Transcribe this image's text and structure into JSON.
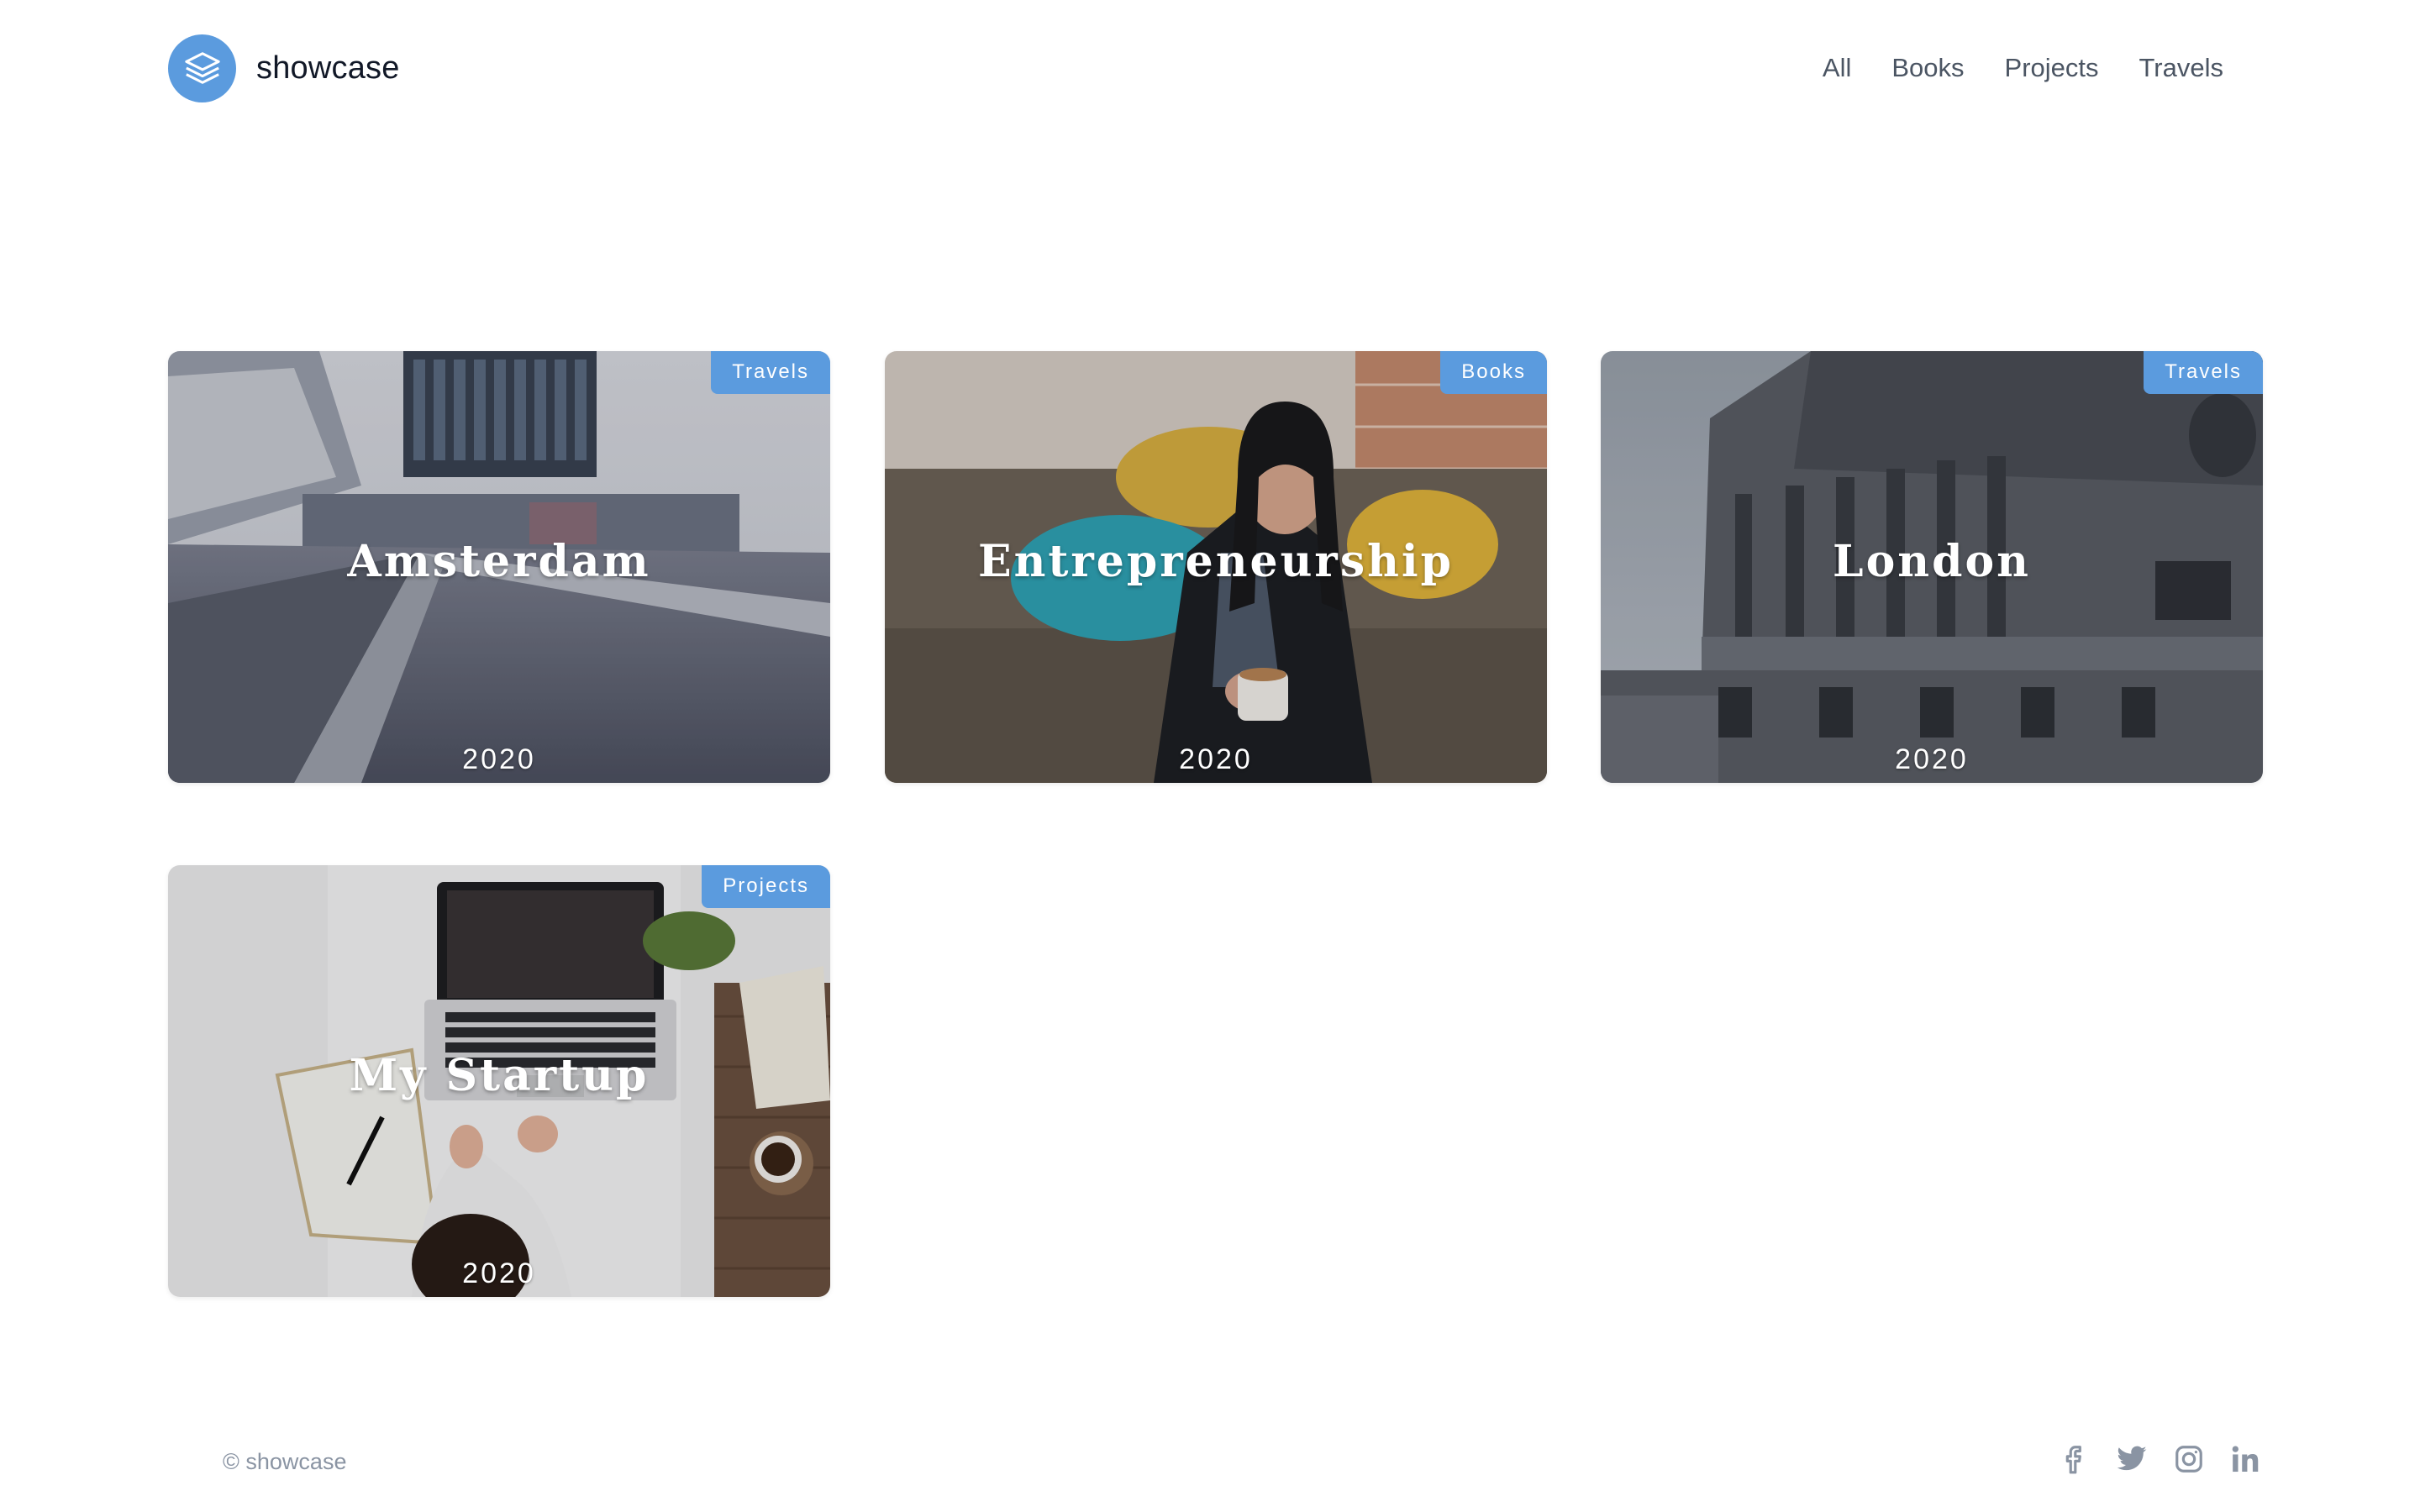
{
  "brand": {
    "name": "showcase",
    "logo_icon": "stacked-layers-icon",
    "accent": "#5b9bde"
  },
  "nav": {
    "items": [
      "All",
      "Books",
      "Projects",
      "Travels"
    ]
  },
  "cards": [
    {
      "title": "Amsterdam",
      "category": "Travels",
      "year": "2020"
    },
    {
      "title": "Entrepreneurship",
      "category": "Books",
      "year": "2020"
    },
    {
      "title": "London",
      "category": "Travels",
      "year": "2020"
    },
    {
      "title": "My Startup",
      "category": "Projects",
      "year": "2020"
    }
  ],
  "footer": {
    "copyright": "© showcase",
    "socials": [
      "facebook-icon",
      "twitter-icon",
      "instagram-icon",
      "linkedin-icon"
    ]
  }
}
